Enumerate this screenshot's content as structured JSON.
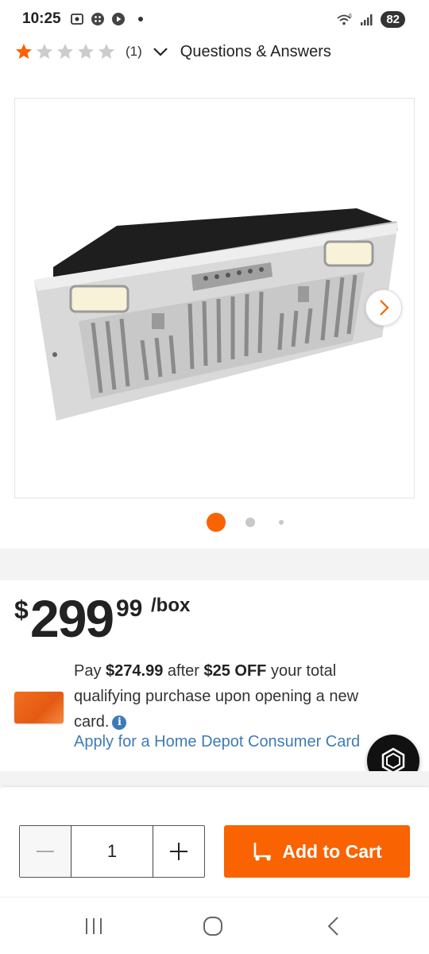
{
  "status_bar": {
    "time": "10:25",
    "battery": "82",
    "icons_left": [
      "screenshot-icon",
      "grid-icon",
      "play-icon"
    ],
    "icons_right": [
      "wifi-icon",
      "signal-icon"
    ]
  },
  "rating": {
    "value": 1,
    "max": 5,
    "count": "(1)",
    "qa_label": "Questions & Answers"
  },
  "gallery": {
    "image_alt": "Stainless steel range hood insert",
    "total_images": 3,
    "current_index": 0
  },
  "price": {
    "currency": "$",
    "dollars": "299",
    "cents": "99",
    "unit": "/box"
  },
  "promo": {
    "text_pay": "Pay ",
    "amount": "$274.99",
    "text_after": " after ",
    "discount": "$25 OFF",
    "text_rest": " your total qualifying purchase upon opening a new card.",
    "apply_link": "Apply for a Home Depot Consumer Card"
  },
  "cart": {
    "quantity": "1",
    "add_label": "Add to Cart"
  },
  "colors": {
    "brand_orange": "#f96302",
    "link_blue": "#3e7bb6",
    "star_filled": "#f96302",
    "star_empty": "#cccccc"
  },
  "nav": [
    "recent-apps-icon",
    "home-icon",
    "back-icon"
  ]
}
